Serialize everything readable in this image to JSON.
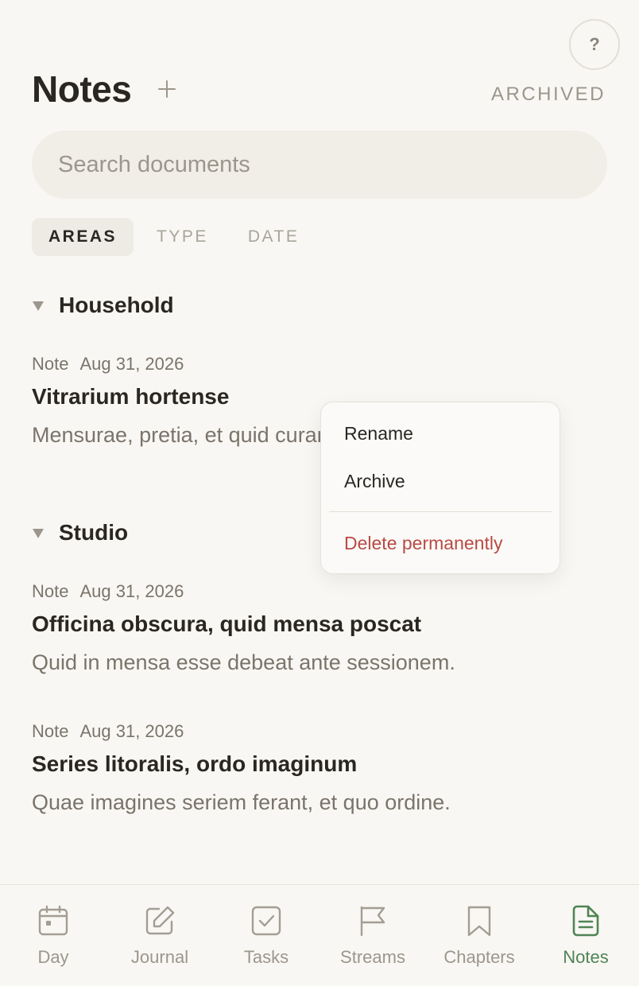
{
  "help": {
    "label": "?"
  },
  "header": {
    "title": "Notes",
    "archived_label": "ARCHIVED"
  },
  "search": {
    "placeholder": "Search documents",
    "value": ""
  },
  "tabs": [
    {
      "label": "AREAS",
      "active": true
    },
    {
      "label": "TYPE",
      "active": false
    },
    {
      "label": "DATE",
      "active": false
    }
  ],
  "sections": [
    {
      "name": "Household",
      "notes": [
        {
          "type": "Note",
          "date": "Aug 31, 2026",
          "title": "Vitrarium hortense",
          "snippet": "Mensurae, pretia, et quid curandum sit."
        }
      ]
    },
    {
      "name": "Studio",
      "notes": [
        {
          "type": "Note",
          "date": "Aug 31, 2026",
          "title": "Officina obscura, quid mensa poscat",
          "snippet": "Quid in mensa esse debeat ante sessionem."
        },
        {
          "type": "Note",
          "date": "Aug 31, 2026",
          "title": "Series litoralis, ordo imaginum",
          "snippet": "Quae imagines seriem ferant, et quo ordine."
        }
      ]
    }
  ],
  "context_menu": {
    "rename": "Rename",
    "archive": "Archive",
    "delete": "Delete permanently"
  },
  "nav": [
    {
      "label": "Day",
      "icon": "calendar-icon",
      "active": false
    },
    {
      "label": "Journal",
      "icon": "edit-icon",
      "active": false
    },
    {
      "label": "Tasks",
      "icon": "checkbox-icon",
      "active": false
    },
    {
      "label": "Streams",
      "icon": "flag-icon",
      "active": false
    },
    {
      "label": "Chapters",
      "icon": "bookmark-icon",
      "active": false
    },
    {
      "label": "Notes",
      "icon": "document-icon",
      "active": true
    }
  ],
  "colors": {
    "accent": "#4f8455",
    "danger": "#b94a44",
    "muted": "#9c968c"
  }
}
